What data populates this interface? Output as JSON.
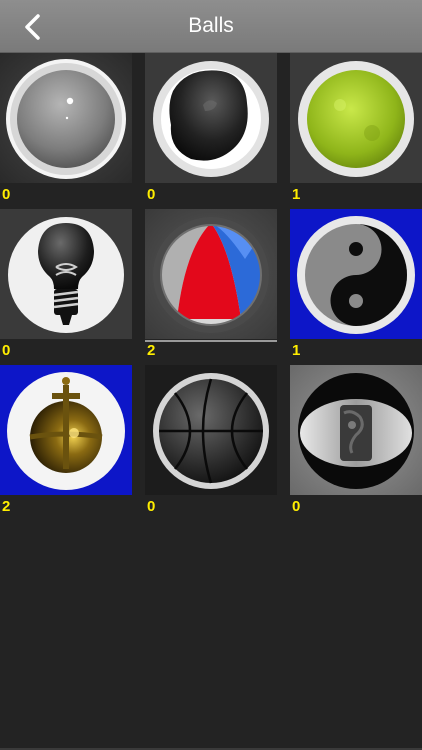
{
  "header": {
    "title": "Balls",
    "back_icon": "chevron-left-icon"
  },
  "balls": [
    {
      "name": "pearl-ball",
      "count": "0"
    },
    {
      "name": "black-blob-ball",
      "count": "0"
    },
    {
      "name": "tennis-ball",
      "count": "1"
    },
    {
      "name": "lightbulb-ball",
      "count": "0"
    },
    {
      "name": "beach-ball",
      "count": "2",
      "selected": true
    },
    {
      "name": "yin-yang-ball",
      "count": "1"
    },
    {
      "name": "orb-ball",
      "count": "2"
    },
    {
      "name": "basketball-ball",
      "count": "0"
    },
    {
      "name": "earth-slice-ball",
      "count": "0"
    }
  ],
  "colors": {
    "topbar": "#858585",
    "background": "#232323",
    "count_text": "#ffee00",
    "blue_tile": "#0d16c8"
  }
}
